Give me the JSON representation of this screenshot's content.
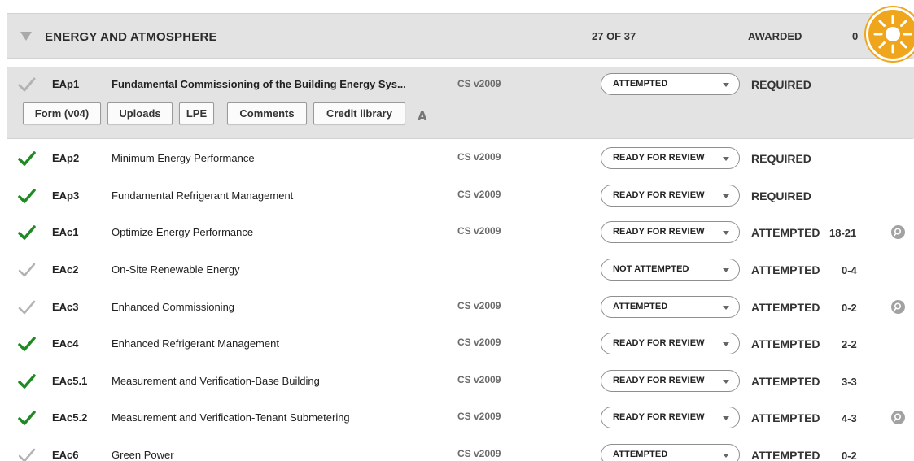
{
  "section": {
    "title": "ENERGY AND ATMOSPHERE",
    "count": "27 OF 37",
    "awarded_label": "AWARDED",
    "awarded_value": "0",
    "badge_icon": "sun-icon",
    "badge_color": "#f0a61c"
  },
  "expanded": {
    "code": "EAp1",
    "name": "Fundamental Commissioning of the Building Energy Sys...",
    "version": "CS v2009",
    "status": "ATTEMPTED",
    "requirement": "REQUIRED",
    "buttons": {
      "form": "Form (v04)",
      "uploads": "Uploads",
      "lpe": "LPE",
      "comments": "Comments",
      "credit_library": "Credit library"
    },
    "font_icon_glyph": "A"
  },
  "credits": [
    {
      "code": "EAp2",
      "name": "Minimum Energy Performance",
      "version": "CS v2009",
      "status": "READY FOR REVIEW",
      "requirement": "REQUIRED",
      "points": "",
      "done": true
    },
    {
      "code": "EAp3",
      "name": "Fundamental Refrigerant Management",
      "version": "CS v2009",
      "status": "READY FOR REVIEW",
      "requirement": "REQUIRED",
      "points": "",
      "done": true
    },
    {
      "code": "EAc1",
      "name": "Optimize Energy Performance",
      "version": "CS v2009",
      "status": "READY FOR REVIEW",
      "requirement": "ATTEMPTED",
      "points": "18-21",
      "done": true
    },
    {
      "code": "EAc2",
      "name": "On-Site Renewable Energy",
      "version": "",
      "status": "NOT ATTEMPTED",
      "requirement": "ATTEMPTED",
      "points": "0-4",
      "done": false
    },
    {
      "code": "EAc3",
      "name": "Enhanced Commissioning",
      "version": "CS v2009",
      "status": "ATTEMPTED",
      "requirement": "ATTEMPTED",
      "points": "0-2",
      "done": false
    },
    {
      "code": "EAc4",
      "name": "Enhanced Refrigerant Management",
      "version": "CS v2009",
      "status": "READY FOR REVIEW",
      "requirement": "ATTEMPTED",
      "points": "2-2",
      "done": true
    },
    {
      "code": "EAc5.1",
      "name": "Measurement and Verification-Base Building",
      "version": "CS v2009",
      "status": "READY FOR REVIEW",
      "requirement": "ATTEMPTED",
      "points": "3-3",
      "done": true
    },
    {
      "code": "EAc5.2",
      "name": "Measurement and Verification-Tenant Submetering",
      "version": "CS v2009",
      "status": "READY FOR REVIEW",
      "requirement": "ATTEMPTED",
      "points": "4-3",
      "done": true
    },
    {
      "code": "EAc6",
      "name": "Green Power",
      "version": "CS v2009",
      "status": "ATTEMPTED",
      "requirement": "ATTEMPTED",
      "points": "0-2",
      "done": false
    }
  ],
  "colors": {
    "check_done": "#1f8a24",
    "check_pending": "#b3b3b3"
  }
}
